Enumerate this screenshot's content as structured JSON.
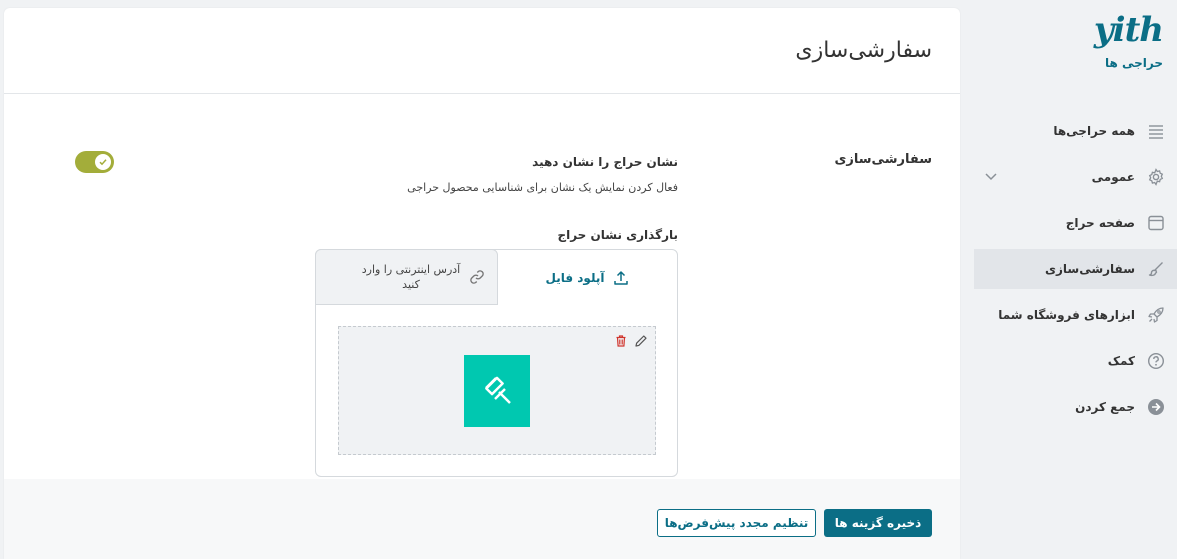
{
  "brand": {
    "logo": "yith",
    "subtitle": "حراجی ها"
  },
  "sidebar": {
    "items": [
      {
        "label": "همه حراجی‌ها",
        "icon": "list-icon"
      },
      {
        "label": "عمومی",
        "icon": "gear-icon",
        "expandable": true
      },
      {
        "label": "صفحه حراج",
        "icon": "window-icon"
      },
      {
        "label": "سفارشی‌سازی",
        "icon": "brush-icon",
        "active": true
      },
      {
        "label": "ابزارهای فروشگاه شما",
        "icon": "rocket-icon"
      },
      {
        "label": "کمک",
        "icon": "help-icon"
      },
      {
        "label": "جمع کردن",
        "icon": "collapse-icon"
      }
    ]
  },
  "page": {
    "title": "سفارشی‌سازی"
  },
  "section": {
    "title": "سفارشی‌سازی"
  },
  "option": {
    "label": "نشان حراج را نشان دهید",
    "description": "فعال کردن نمایش یک نشان برای شناسایی محصول حراجی",
    "enabled": true
  },
  "upload": {
    "label": "بارگذاری نشان حراج",
    "tab_file": "آپلود فایل",
    "tab_url": "آدرس اینترنتی را وارد کنید"
  },
  "footer": {
    "save_label": "ذخیره گزینه ها",
    "reset_label": "تنظیم مجدد پیش‌فرض‌ها"
  },
  "colors": {
    "accent": "#0b6e86",
    "toggle_on": "#a3ad3a",
    "badge": "#00c8b0",
    "delete": "#d0342c"
  }
}
